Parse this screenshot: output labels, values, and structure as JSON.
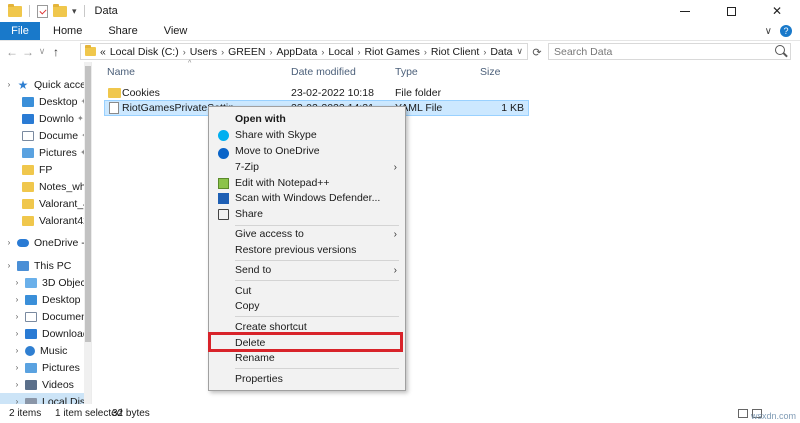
{
  "window": {
    "title": "Data",
    "minimize": "—",
    "maximize": "",
    "close": "✕"
  },
  "ribbon": {
    "file": "File",
    "home": "Home",
    "share": "Share",
    "view": "View",
    "expand": "∨"
  },
  "nav": {
    "back": "←",
    "forward": "→",
    "recent": "∨",
    "up": "↑"
  },
  "address": {
    "prefix": "«",
    "crumbs": [
      "Local Disk (C:)",
      "Users",
      "GREEN",
      "AppData",
      "Local",
      "Riot Games",
      "Riot Client",
      "Data"
    ],
    "sep": "›",
    "dropdown": "∨",
    "refresh": "⟳"
  },
  "search": {
    "placeholder": "Search Data"
  },
  "sidebar": {
    "items": [
      {
        "label": "Quick access",
        "expander": "›"
      },
      {
        "label": "Desktop",
        "pin": "📌"
      },
      {
        "label": "Downlo",
        "pin": "📌"
      },
      {
        "label": "Docume",
        "pin": "📌"
      },
      {
        "label": "Pictures",
        "pin": "📌"
      },
      {
        "label": "FP"
      },
      {
        "label": "Notes_wha"
      },
      {
        "label": "Valorant_43"
      },
      {
        "label": "Valorant42_"
      },
      {
        "label": "OneDrive - P",
        "expander": "›"
      },
      {
        "label": "This PC",
        "expander": "›"
      },
      {
        "label": "3D Objects",
        "expander": "›"
      },
      {
        "label": "Desktop",
        "expander": "›"
      },
      {
        "label": "Documents",
        "expander": "›"
      },
      {
        "label": "Downloads",
        "expander": "›"
      },
      {
        "label": "Music",
        "expander": "›"
      },
      {
        "label": "Pictures",
        "expander": "›"
      },
      {
        "label": "Videos",
        "expander": "›"
      },
      {
        "label": "Local Disk (",
        "expander": "›"
      }
    ]
  },
  "columns": {
    "name": "Name",
    "date": "Date modified",
    "type": "Type",
    "size": "Size",
    "sort_caret": "^"
  },
  "files": [
    {
      "name": "Cookies",
      "date": "23-02-2022 10:18",
      "type": "File folder",
      "size": ""
    },
    {
      "name": "RiotGamesPrivateSettin",
      "date": "23-02-2022 14:31",
      "type": "YAML File",
      "size": "1 KB"
    }
  ],
  "context_menu": {
    "open_with": "Open with",
    "share_skype": "Share with Skype",
    "move_onedrive": "Move to OneDrive",
    "zip": "7-Zip",
    "notepadpp": "Edit with Notepad++",
    "defender": "Scan with Windows Defender...",
    "share": "Share",
    "give_access": "Give access to",
    "restore": "Restore previous versions",
    "send_to": "Send to",
    "cut": "Cut",
    "copy": "Copy",
    "create_shortcut": "Create shortcut",
    "delete": "Delete",
    "rename": "Rename",
    "properties": "Properties",
    "submenu_arrow": "›"
  },
  "status": {
    "items": "2 items",
    "selected": "1 item selected",
    "size": "32 bytes"
  },
  "watermark": "wsxdn.com",
  "colors": {
    "file_tab": "#1979ca",
    "selection": "#cce8ff",
    "highlight_box": "#d8232a"
  }
}
